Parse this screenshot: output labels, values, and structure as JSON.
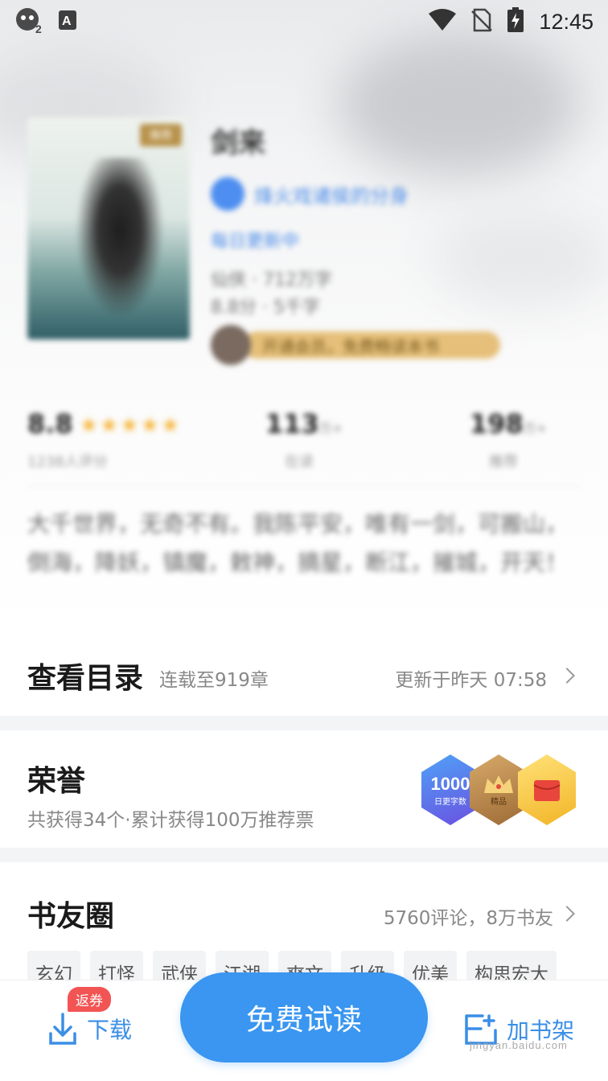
{
  "status_bar": {
    "time": "12:45"
  },
  "book": {
    "title": "剑来",
    "cover_tag": "推荐",
    "author": "烽火戏诸侯的分身",
    "sub_link": "每日更新中",
    "meta_line1": "仙侠 · 712万字",
    "meta_line2": "8.8分 · 5千字",
    "promo": "开通会员，免费畅读本书",
    "stats": [
      {
        "value": "8.8",
        "unit": "",
        "label": "1238人评分"
      },
      {
        "value": "113",
        "unit": "万+",
        "label": "在读"
      },
      {
        "value": "198",
        "unit": "万+",
        "label": "推荐"
      }
    ],
    "description": "大千世界，无奇不有。我陈平安，唯有一剑，可搬山，倒海，降妖，镇魔，敕神，摘星，断江，摧城，开天！"
  },
  "toc": {
    "title": "查看目录",
    "serial": "连载至919章",
    "updated": "更新于昨天 07:58"
  },
  "honor": {
    "title": "荣誉",
    "summary": "共获得34个·累计获得100万推荐票",
    "badges": [
      {
        "big": "1000",
        "small": "日更字数",
        "color": "#6a55e0"
      },
      {
        "big": "",
        "small": "精品",
        "color": "#b88446"
      },
      {
        "big": "",
        "small": "",
        "color": "#f6c53a"
      }
    ]
  },
  "circle": {
    "title": "书友圈",
    "stats": "5760评论，8万书友",
    "tags": [
      "玄幻",
      "打怪",
      "武侠",
      "江湖",
      "爽文",
      "升级",
      "优美",
      "构思宏大"
    ]
  },
  "bottom": {
    "download_label": "下载",
    "coupon_badge": "返券",
    "read_button": "免费试读",
    "shelf_label": "加书架"
  },
  "watermark": "jingyan.baidu.com",
  "colors": {
    "accent": "#3a96f0",
    "link": "#3a8ee6",
    "coupon": "#f25454",
    "star": "#f6b73c"
  }
}
